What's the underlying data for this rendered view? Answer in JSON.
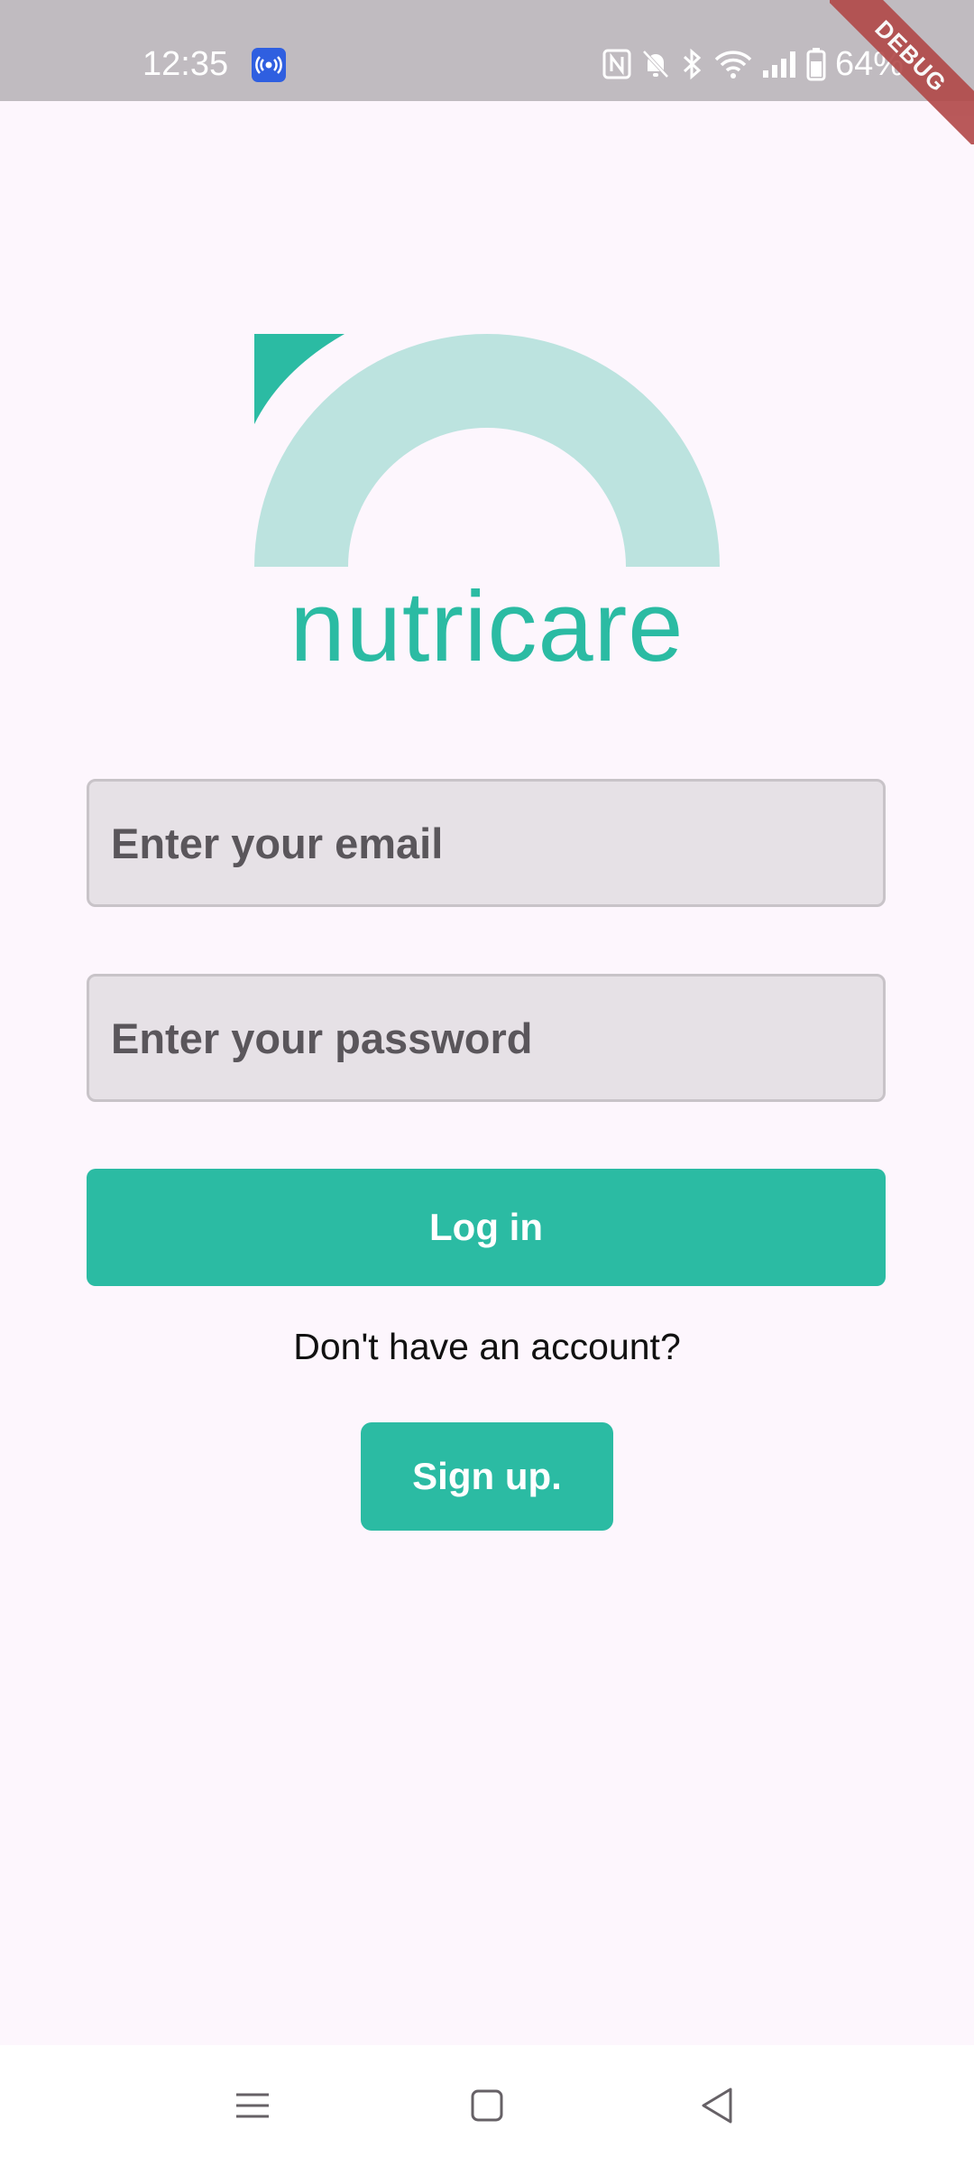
{
  "status_bar": {
    "time": "12:35",
    "battery": "64%",
    "icons": [
      "cast-icon",
      "nfc-icon",
      "bell-off-icon",
      "bluetooth-icon",
      "wifi-icon",
      "signal-icon",
      "battery-icon"
    ]
  },
  "debug_banner": "DEBUG",
  "logo": {
    "text": "nutricare",
    "colors": {
      "primary": "#2BBBA3",
      "light": "#BCE3DF"
    }
  },
  "form": {
    "email_placeholder": "Enter your email",
    "email_value": "",
    "password_placeholder": "Enter your password",
    "password_value": "",
    "login_label": "Log in",
    "signup_prompt": "Don't have an account?",
    "signup_label": "Sign up."
  },
  "nav_bar": {
    "icons": [
      "menu-icon",
      "home-icon",
      "back-icon"
    ]
  },
  "colors": {
    "accent": "#2BBBA3",
    "background": "#FDF6FD",
    "status_bar": "#C0BBC0"
  }
}
